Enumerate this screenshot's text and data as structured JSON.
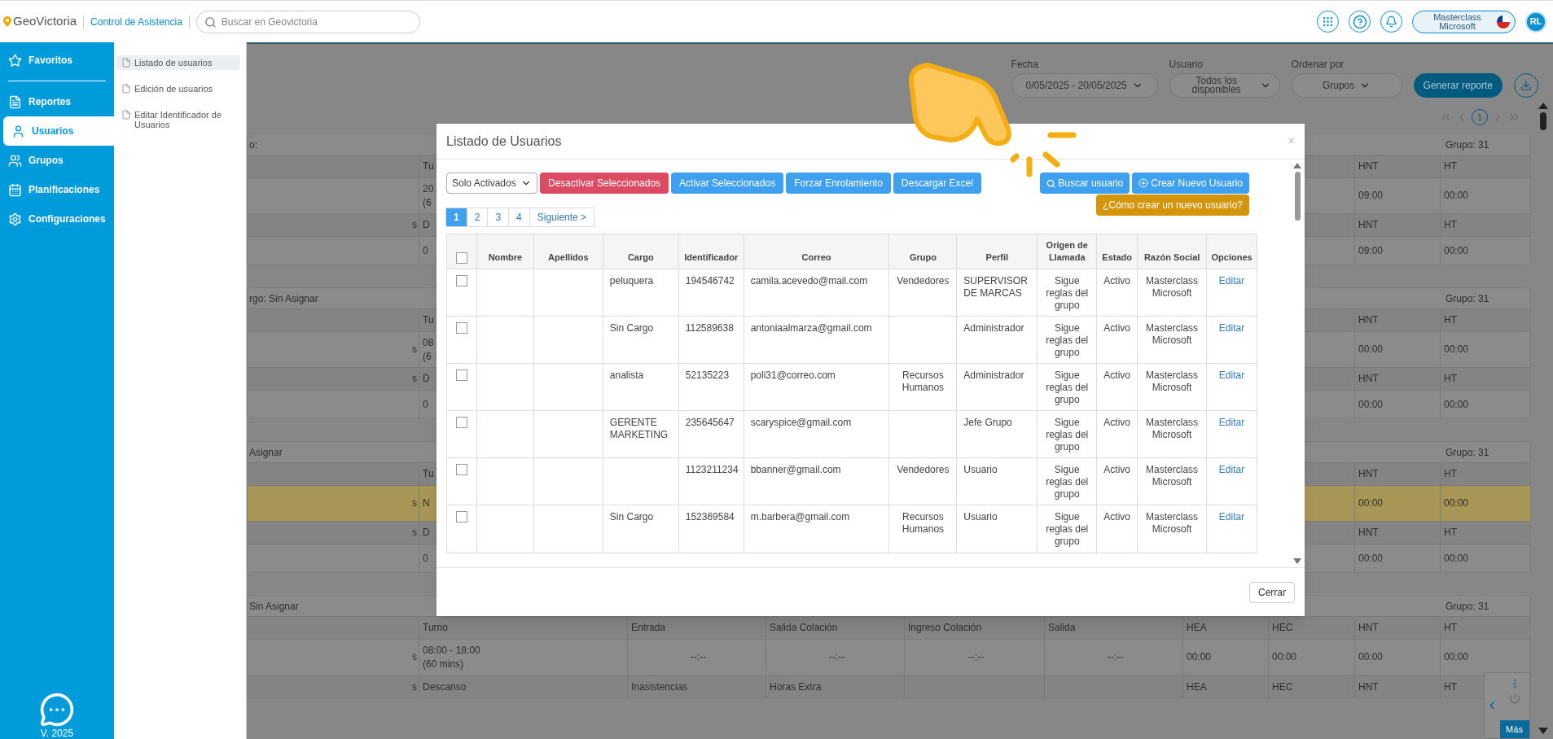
{
  "header": {
    "logo": "GeoVictoria",
    "product": "Control de Asistencia",
    "search": {
      "placeholder": "Buscar en Geovictoria"
    },
    "company": "Masterclass Microsoft",
    "avatar": "RL"
  },
  "sidebar": {
    "items": [
      {
        "label": "Favoritos",
        "selected": false
      },
      {
        "label": "Reportes",
        "selected": false
      },
      {
        "label": "Usuarios",
        "selected": true
      },
      {
        "label": "Grupos",
        "selected": false
      },
      {
        "label": "Planificaciones",
        "selected": false
      },
      {
        "label": "Configuraciones",
        "selected": false
      }
    ],
    "version": "V. 2025"
  },
  "submenu": {
    "items": [
      {
        "label": "Listado de usuarios",
        "selected": true
      },
      {
        "label": "Edición de usuarios",
        "selected": false
      },
      {
        "label": "Editar Identificador de Usuarios",
        "selected": false
      }
    ]
  },
  "filters": [
    {
      "label": "Fecha",
      "value": "0/05/2025 - 20/05/2025"
    },
    {
      "label": "Usuario",
      "value": "Todos los disponibles"
    },
    {
      "label": "Ordenar por",
      "value": "Grupos"
    }
  ],
  "generate_button": "Generar reporte",
  "report_pagination": [
    {
      "label": "1",
      "selected": true
    }
  ],
  "cards": [
    {
      "title": "o:",
      "group": "Grupo: 31",
      "rows": [
        {
          "kind": "header",
          "highlighted": false,
          "cells": {
            "turno": "Tu",
            "hnt": "HNT",
            "ht": "HT"
          }
        },
        {
          "kind": "data",
          "highlighted": false,
          "cells": {
            "turno": "20\n(6",
            "hnt": "09:00",
            "ht": "00:00"
          }
        },
        {
          "kind": "header",
          "highlighted": false,
          "cells": {
            "name": "s",
            "turno": "D",
            "hnt": "HNT",
            "ht": "HT"
          }
        },
        {
          "kind": "data",
          "highlighted": false,
          "cells": {
            "turno": "0",
            "hnt": "09:00",
            "ht": "00:00"
          }
        }
      ]
    },
    {
      "title": "rgo: Sin Asignar",
      "group": "Grupo: 31",
      "rows": [
        {
          "kind": "header",
          "highlighted": false,
          "cells": {
            "turno": "Tu",
            "hnt": "HNT",
            "ht": "HT"
          }
        },
        {
          "kind": "data",
          "highlighted": false,
          "cells": {
            "name": "s",
            "turno": "08\n(6",
            "hnt": "00:00",
            "ht": "00:00"
          }
        },
        {
          "kind": "header",
          "highlighted": false,
          "cells": {
            "name": "s",
            "turno": "D",
            "hnt": "HNT",
            "ht": "HT"
          }
        },
        {
          "kind": "data",
          "highlighted": false,
          "cells": {
            "turno": "0",
            "hnt": "00:00",
            "ht": "00:00"
          }
        }
      ]
    },
    {
      "title": "Asignar",
      "group": "Grupo: 31",
      "rows": [
        {
          "kind": "header",
          "highlighted": false,
          "cells": {
            "turno": "Tu",
            "hnt": "HNT",
            "ht": "HT"
          }
        },
        {
          "kind": "data",
          "highlighted": true,
          "cells": {
            "name": "s",
            "turno": "N",
            "hnt": "00:00",
            "ht": "00:00"
          }
        },
        {
          "kind": "header",
          "highlighted": false,
          "cells": {
            "name": "s",
            "turno": "D",
            "hnt": "HNT",
            "ht": "HT"
          }
        },
        {
          "kind": "data",
          "highlighted": false,
          "cells": {
            "turno": "0",
            "hnt": "00:00",
            "ht": "00:00"
          }
        }
      ]
    },
    {
      "title": "Sin Asignar",
      "group": "Grupo: 31",
      "rows": [
        {
          "kind": "header",
          "highlighted": false,
          "cells": {
            "turno": "Turno",
            "entrada": "Entrada",
            "salida_colacion": "Salida Colación",
            "ingreso_colacion": "Ingreso Colación",
            "salida": "Salida",
            "hea": "HEA",
            "hec": "HEC",
            "hnt": "HNT",
            "ht": "HT"
          }
        },
        {
          "kind": "data",
          "highlighted": false,
          "cells": {
            "name": "s",
            "turno": "08:00 - 18:00\n(60 mins)",
            "entrada": "--:--",
            "salida_colacion": "--:--",
            "ingreso_colacion": "--:--",
            "salida": "--:--",
            "hea": "00:00",
            "hec": "00:00",
            "hnt": "00:00",
            "ht": "00:00"
          }
        },
        {
          "kind": "header",
          "highlighted": false,
          "cells": {
            "name": "s",
            "turno": "Descanso",
            "entrada": "Inasistencias",
            "salida_colacion": "Horas Extra",
            "hea": "HEA",
            "hec": "HEC",
            "hnt": "HNT",
            "ht": "HT"
          }
        }
      ]
    }
  ],
  "modal": {
    "title": "Listado de Usuarios",
    "close": "×",
    "status_filter": "Solo Activados",
    "actions": [
      {
        "label": "Desactivar Seleccionados",
        "kind": "danger"
      },
      {
        "label": "Activar Seleccionados",
        "kind": "primary"
      },
      {
        "label": "Forzar Enrolamiento",
        "kind": "primary"
      },
      {
        "label": "Descargar Excel",
        "kind": "primary"
      }
    ],
    "search_button": "Buscar usuario",
    "create_button": "Crear Nuevo Usuario",
    "help_button": "¿Cómo crear un nuevo usuario?",
    "pages": [
      {
        "label": "1",
        "selected": true
      },
      {
        "label": "2",
        "selected": false
      },
      {
        "label": "3",
        "selected": false
      },
      {
        "label": "4",
        "selected": false
      },
      {
        "label": "Siguiente >",
        "selected": false
      }
    ],
    "select_all_checked": false,
    "columns": [
      "Nombre",
      "Apellidos",
      "Cargo",
      "Identificador",
      "Correo",
      "Grupo",
      "Perfil",
      "Origen de Llamada",
      "Estado",
      "Razón Social",
      "Opciones"
    ],
    "rows": [
      {
        "checked": false,
        "cargo": "peluquera",
        "identificador": "194546742",
        "correo": "camila.acevedo@mail.com",
        "grupo": "Vendedores",
        "perfil": "SUPERVISOR DE MARCAS",
        "origen": "Sigue reglas del grupo",
        "estado": "Activo",
        "razon_social": "Masterclass Microsoft",
        "opcion": "Editar"
      },
      {
        "checked": false,
        "cargo": "Sin Cargo",
        "identificador": "112589638",
        "correo": "antoniaalmarza@gmail.com",
        "perfil": "Administrador",
        "origen": "Sigue reglas del grupo",
        "estado": "Activo",
        "razon_social": "Masterclass Microsoft",
        "opcion": "Editar"
      },
      {
        "checked": false,
        "cargo": "analista",
        "identificador": "52135223",
        "correo": "poli31@correo.com",
        "grupo": "Recursos Humanos",
        "perfil": "Administrador",
        "origen": "Sigue reglas del grupo",
        "estado": "Activo",
        "razon_social": "Masterclass Microsoft",
        "opcion": "Editar"
      },
      {
        "checked": false,
        "cargo": "GERENTE MARKETING",
        "identificador": "235645647",
        "correo": "scaryspice@gmail.com",
        "perfil": "Jefe Grupo",
        "origen": "Sigue reglas del grupo",
        "estado": "Activo",
        "razon_social": "Masterclass Microsoft",
        "opcion": "Editar"
      },
      {
        "checked": false,
        "identificador": "1123211234",
        "correo": "bbanner@gmail.com",
        "grupo": "Vendedores",
        "perfil": "Usuario",
        "origen": "Sigue reglas del grupo",
        "estado": "Activo",
        "razon_social": "Masterclass Microsoft",
        "opcion": "Editar"
      },
      {
        "checked": false,
        "cargo": "Sin Cargo",
        "identificador": "152369584",
        "correo": "m.barbera@gmail.com",
        "grupo": "Recursos Humanos",
        "perfil": "Usuario",
        "origen": "Sigue reglas del grupo",
        "estado": "Activo",
        "razon_social": "Masterclass Microsoft",
        "opcion": "Editar"
      }
    ],
    "footer_button": "Cerrar"
  },
  "more_widget": {
    "label": "Más"
  }
}
